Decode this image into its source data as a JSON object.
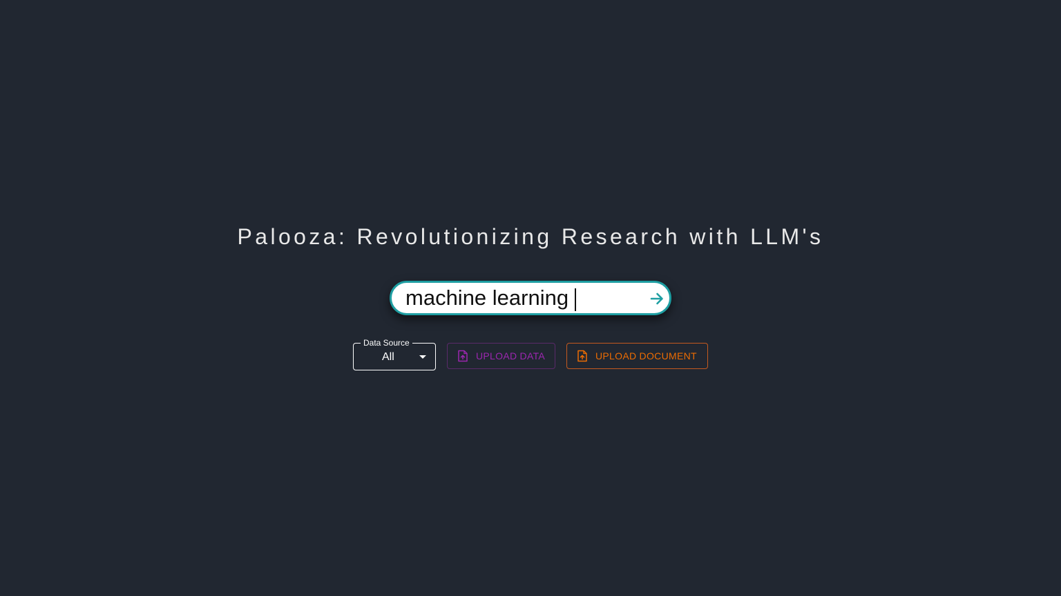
{
  "header": {
    "title": "Palooza: Revolutionizing Research with LLM's"
  },
  "search": {
    "value": "machine learning",
    "submit_icon": "arrow-right-icon"
  },
  "controls": {
    "data_source": {
      "label": "Data Source",
      "selected": "All"
    },
    "upload_data": {
      "label": "UPLOAD DATA",
      "icon": "file-upload-icon",
      "color": "#9c27b0"
    },
    "upload_document": {
      "label": "UPLOAD DOCUMENT",
      "icon": "file-upload-icon",
      "color": "#ed6c02"
    }
  },
  "colors": {
    "background": "#212731",
    "search_border": "#1e9ea2"
  }
}
